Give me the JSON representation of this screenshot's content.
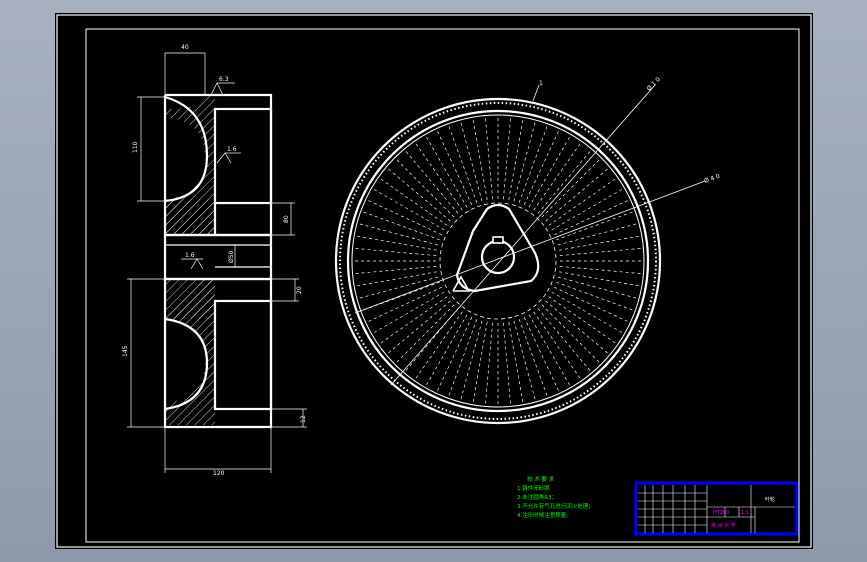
{
  "colors": {
    "line": "#ffffff",
    "dim": "#ffffff",
    "notes": "#00ff00",
    "title_block": "#ff00ff",
    "title_border": "#0000ff",
    "background": "#000000"
  },
  "section_view": {
    "dims": {
      "top_width": "40",
      "cup_height": "110",
      "hub_bore": "80",
      "flange_gap": "20",
      "lower_height": "145",
      "bottom_width": "120",
      "base_step": "12",
      "shaft": "Ø50"
    },
    "roughness": {
      "r1": "6.3",
      "r2": "1.6",
      "r3": "1.6"
    }
  },
  "front_view": {
    "dims": {
      "outer_dia": "Ø 1 0",
      "rim_dia": "Ø 4 0",
      "rim_width": "1"
    },
    "blade_count": 72
  },
  "tech_notes": {
    "title": "技 术 要 求",
    "lines": [
      "1.铸件无砂眼",
      "2.未注圆角R3；",
      "3.不允许有气孔进行回火处理；",
      "4.注形时候注意质量。"
    ]
  },
  "title_block": {
    "part_name": "叶轮",
    "material": "HT200",
    "scale": "1:1",
    "school_row": "常 州 大 学"
  }
}
